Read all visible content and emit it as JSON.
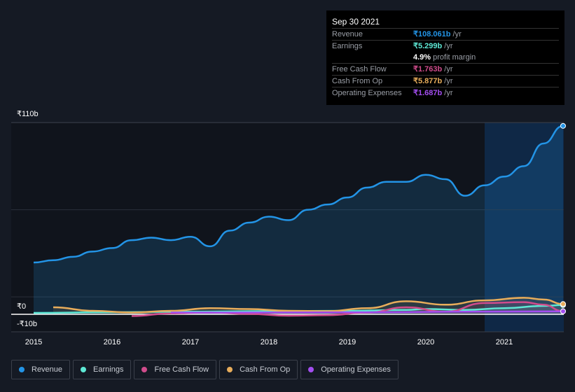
{
  "tooltip": {
    "date": "Sep 30 2021",
    "rows": [
      {
        "label": "Revenue",
        "value": "₹108.061b",
        "unit": " /yr",
        "color": "#2394e6"
      },
      {
        "label": "Earnings",
        "value": "₹5.299b",
        "unit": " /yr",
        "color": "#5ee8d5"
      },
      {
        "label": "",
        "value": "4.9%",
        "unit": " profit margin",
        "color": "#ffffff"
      },
      {
        "label": "Free Cash Flow",
        "value": "₹1.763b",
        "unit": " /yr",
        "color": "#d04c8c"
      },
      {
        "label": "Cash From Op",
        "value": "₹5.877b",
        "unit": " /yr",
        "color": "#e8ad5b"
      },
      {
        "label": "Operating Expenses",
        "value": "₹1.687b",
        "unit": " /yr",
        "color": "#a34ef0"
      }
    ]
  },
  "chart_data": {
    "type": "line",
    "y_tick_labels": [
      "₹110b",
      "₹0",
      "-₹10b"
    ],
    "ylim": [
      -10,
      110
    ],
    "x_tick_labels": [
      "2015",
      "2016",
      "2017",
      "2018",
      "2019",
      "2020",
      "2021"
    ],
    "xlim": [
      2014.7,
      2021.75
    ],
    "highlight_from": 2020.75,
    "series": [
      {
        "name": "Revenue",
        "color": "#2394e6",
        "fill": true,
        "x": [
          2015,
          2015.25,
          2015.5,
          2015.75,
          2016,
          2016.25,
          2016.5,
          2016.75,
          2017,
          2017.25,
          2017.5,
          2017.75,
          2018,
          2018.25,
          2018.5,
          2018.75,
          2019,
          2019.25,
          2019.5,
          2019.75,
          2020,
          2020.25,
          2020.5,
          2020.75,
          2021,
          2021.25,
          2021.5,
          2021.75
        ],
        "y": [
          29.7,
          31,
          33,
          36,
          38,
          42.5,
          44,
          42.5,
          44.5,
          39,
          48,
          52.6,
          56,
          54,
          60,
          63,
          67,
          72.7,
          76,
          76,
          80,
          77.5,
          68,
          74,
          79,
          85,
          98,
          108.1
        ]
      },
      {
        "name": "Earnings",
        "color": "#5ee8d5",
        "x": [
          2015,
          2016,
          2017,
          2018,
          2019,
          2019.75,
          2020,
          2020.5,
          2021,
          2021.5,
          2021.75
        ],
        "y": [
          0.8,
          1.2,
          1.5,
          1.8,
          2,
          2.5,
          3,
          2.5,
          3.5,
          4.8,
          5.3
        ]
      },
      {
        "name": "Free Cash Flow",
        "color": "#d04c8c",
        "x": [
          2016.25,
          2016.75,
          2017.25,
          2017.75,
          2018.25,
          2018.75,
          2019.25,
          2019.75,
          2020.25,
          2020.75,
          2021.25,
          2021.5,
          2021.75
        ],
        "y": [
          -1,
          0.5,
          1,
          0.2,
          -0.8,
          -0.5,
          1,
          4,
          1.5,
          6.5,
          7,
          5.5,
          1.8
        ]
      },
      {
        "name": "Cash From Op",
        "color": "#e8ad5b",
        "x": [
          2015.25,
          2015.75,
          2016.25,
          2016.75,
          2017.25,
          2017.75,
          2018.25,
          2018.75,
          2019.25,
          2019.75,
          2020.25,
          2020.75,
          2021.25,
          2021.5,
          2021.75
        ],
        "y": [
          4,
          2,
          1,
          2,
          3.5,
          3,
          2,
          1.8,
          3.5,
          7.5,
          5.5,
          8,
          9.5,
          8.5,
          5.9
        ]
      },
      {
        "name": "Operating Expenses",
        "color": "#a34ef0",
        "x": [
          2016.75,
          2017.5,
          2018.5,
          2019.5,
          2020.5,
          2021.75
        ],
        "y": [
          1,
          1,
          1.1,
          1.2,
          1.5,
          1.7
        ]
      }
    ]
  },
  "legend": [
    "Revenue",
    "Earnings",
    "Free Cash Flow",
    "Cash From Op",
    "Operating Expenses"
  ]
}
